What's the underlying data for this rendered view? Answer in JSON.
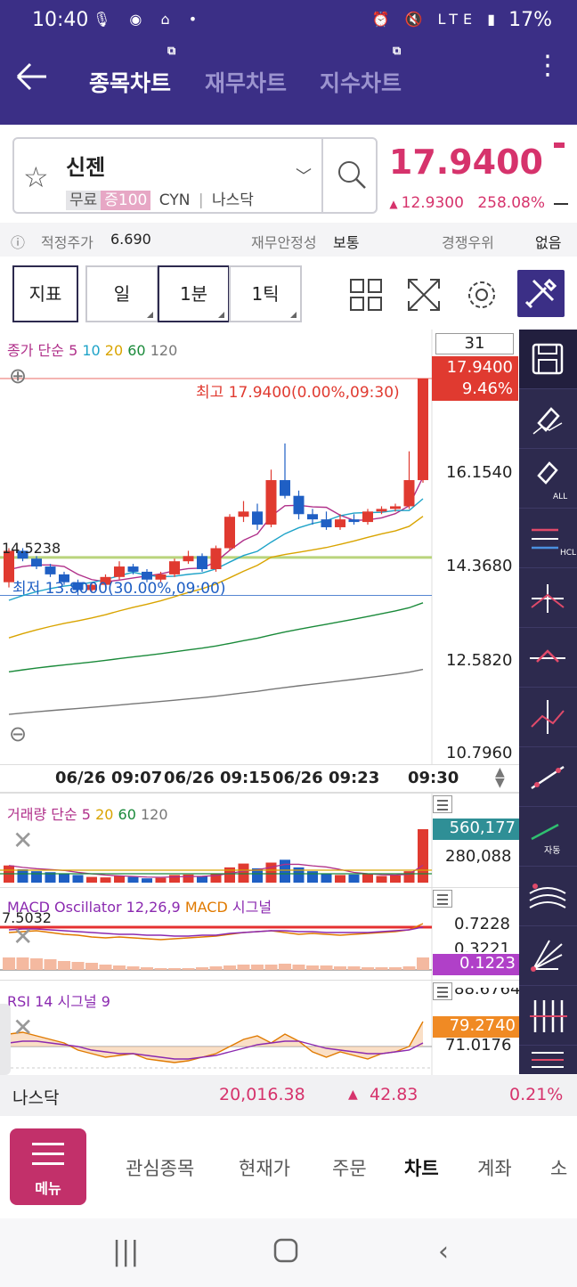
{
  "status": {
    "time": "10:40",
    "left_icons": "🎙 ◉ ⌂ •",
    "right_icons": "⏰ 🔇 LTE ▮",
    "battery": "17%"
  },
  "header": {
    "tabs": [
      {
        "label": "종목차트",
        "active": true
      },
      {
        "label": "재무차트",
        "active": false
      },
      {
        "label": "지수차트",
        "active": false
      }
    ]
  },
  "stock": {
    "name": "신젠",
    "tag1": "무료",
    "tag2": "증100",
    "ticker": "CYN",
    "market": "나스닥",
    "price": "17.9400",
    "change": "12.9300",
    "change_pct": "258.08%",
    "up_color": "#d6336c"
  },
  "info": {
    "fair_label": "적정주가",
    "fair_value": "6.690",
    "fin_label": "재무안정성",
    "fin_value": "보통",
    "comp_label": "경쟁우위",
    "comp_value": "없음"
  },
  "toolbar": {
    "indicator": "지표",
    "day": "일",
    "min1": "1분",
    "tick1": "1틱"
  },
  "chart": {
    "legend": {
      "prefix": "종가 단순",
      "ma": [
        "5",
        "10",
        "20",
        "60",
        "120"
      ]
    },
    "count_box": "31",
    "last_price": "17.9400",
    "last_pct": "9.46%",
    "high_label": "최고 17.9400(0.00%,09:30)",
    "low_label": "최저 13.8000(30.00%,09:00)",
    "ref_price": "14.5238",
    "y_ticks": [
      "16.1540",
      "14.3680",
      "12.5820",
      "10.7960"
    ],
    "x_ticks": [
      "06/26 09:07",
      "06/26 09:15",
      "06/26 09:23",
      "09:30"
    ]
  },
  "volume": {
    "legend_prefix": "거래량 단순",
    "ma": [
      "5",
      "20",
      "60",
      "120"
    ],
    "last": "560,177",
    "tick": "280,088"
  },
  "macd": {
    "legend": "MACD Oscillator 12,26,9",
    "legend2": "MACD",
    "legend3": "시그널",
    "left_val": "7.5032",
    "tick1": "0.7228",
    "tick2": "0.3221",
    "last": "0.1223"
  },
  "rsi": {
    "legend": "RSI 14",
    "legend2": "시그널 9",
    "tick_top": "88.6764",
    "last": "79.2740",
    "tick2": "71.0176"
  },
  "index_bar": {
    "name": "나스닥",
    "value": "20,016.38",
    "change": "42.83",
    "pct": "0.21%"
  },
  "bottom_nav": {
    "menu": "메뉴",
    "items": [
      {
        "label": "관심종목",
        "active": false
      },
      {
        "label": "현재가",
        "active": false
      },
      {
        "label": "주문",
        "active": false
      },
      {
        "label": "차트",
        "active": true
      },
      {
        "label": "계좌",
        "active": false
      },
      {
        "label": "소",
        "active": false
      }
    ]
  },
  "chart_data": {
    "type": "candlestick",
    "x": [
      "09:00",
      "09:01",
      "09:02",
      "09:03",
      "09:04",
      "09:05",
      "09:06",
      "09:07",
      "09:08",
      "09:09",
      "09:10",
      "09:11",
      "09:12",
      "09:13",
      "09:14",
      "09:15",
      "09:16",
      "09:17",
      "09:18",
      "09:19",
      "09:20",
      "09:21",
      "09:22",
      "09:23",
      "09:24",
      "09:25",
      "09:26",
      "09:27",
      "09:28",
      "09:29",
      "09:30"
    ],
    "open": [
      14.05,
      14.65,
      14.5,
      14.35,
      14.2,
      14.05,
      13.9,
      14.0,
      14.15,
      14.35,
      14.25,
      14.1,
      14.2,
      14.45,
      14.55,
      14.3,
      14.7,
      15.3,
      15.4,
      15.15,
      16.0,
      15.7,
      15.35,
      15.25,
      15.1,
      15.25,
      15.2,
      15.4,
      15.45,
      15.5,
      16.0
    ],
    "close": [
      14.65,
      14.5,
      14.35,
      14.2,
      14.05,
      13.9,
      14.0,
      14.15,
      14.35,
      14.25,
      14.1,
      14.2,
      14.45,
      14.55,
      14.3,
      14.7,
      15.3,
      15.4,
      15.15,
      16.0,
      15.7,
      15.35,
      15.25,
      15.1,
      15.25,
      15.2,
      15.4,
      15.45,
      15.5,
      16.0,
      17.94
    ],
    "high": [
      14.7,
      14.7,
      14.55,
      14.4,
      14.25,
      14.1,
      14.05,
      14.2,
      14.45,
      14.4,
      14.3,
      14.25,
      14.5,
      14.65,
      14.6,
      14.75,
      15.35,
      15.6,
      15.55,
      16.2,
      16.7,
      15.8,
      15.45,
      15.4,
      15.35,
      15.35,
      15.45,
      15.5,
      15.55,
      16.55,
      17.94
    ],
    "low": [
      13.95,
      14.45,
      14.3,
      14.15,
      14.0,
      13.8,
      13.85,
      13.95,
      14.1,
      14.2,
      14.05,
      14.05,
      14.15,
      14.4,
      14.25,
      14.25,
      14.65,
      15.2,
      15.05,
      15.1,
      15.65,
      15.25,
      15.15,
      15.05,
      15.05,
      15.15,
      15.15,
      15.35,
      15.4,
      15.45,
      15.95
    ],
    "volume": [
      180000,
      140000,
      120000,
      110000,
      90000,
      80000,
      60000,
      55000,
      70000,
      60000,
      45000,
      50000,
      80000,
      85000,
      70000,
      90000,
      160000,
      200000,
      150000,
      210000,
      240000,
      160000,
      120000,
      90000,
      80000,
      85000,
      90000,
      70000,
      75000,
      120000,
      560177
    ],
    "ylim": [
      10.796,
      17.94
    ]
  }
}
